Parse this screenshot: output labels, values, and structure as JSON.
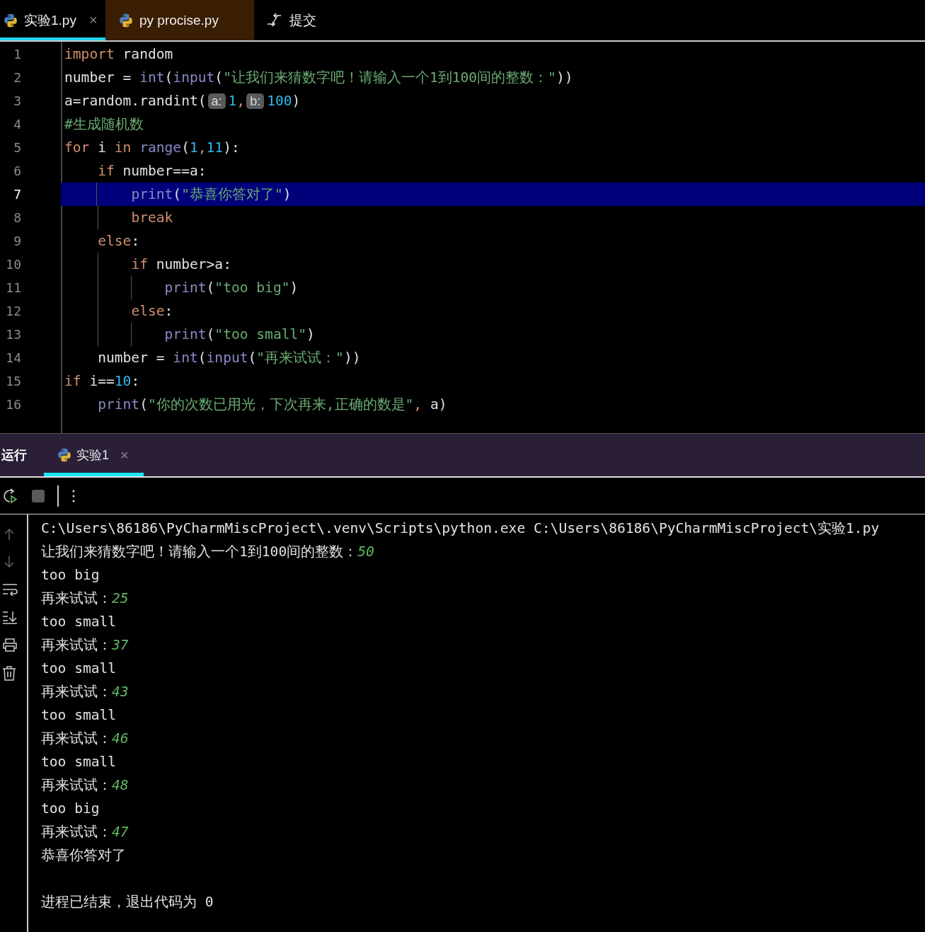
{
  "editor_tabs": [
    {
      "kind": "file",
      "label": "实验1.py",
      "selected": true,
      "close": "×"
    },
    {
      "kind": "file",
      "label": "py procise.py",
      "selected": false,
      "color": "#3a1e03"
    },
    {
      "kind": "action",
      "label": "提交",
      "selected": false
    }
  ],
  "code_lines": [
    {
      "number": "1",
      "selected": false,
      "tokens": [
        {
          "kind": "keyword",
          "text": "import"
        },
        {
          "kind": "plain",
          "text": " random"
        }
      ]
    },
    {
      "number": "2",
      "selected": false,
      "tokens": [
        {
          "kind": "plain",
          "text": "number = "
        },
        {
          "kind": "builtin",
          "text": "int"
        },
        {
          "kind": "plain",
          "text": "("
        },
        {
          "kind": "builtin",
          "text": "input"
        },
        {
          "kind": "plain",
          "text": "("
        },
        {
          "kind": "string",
          "text": "\"让我们来猜数字吧！请输入一个1到100间的整数：\""
        },
        {
          "kind": "plain",
          "text": "))"
        }
      ]
    },
    {
      "number": "3",
      "selected": false,
      "tokens": [
        {
          "kind": "plain",
          "text": "a=random.randint("
        },
        {
          "kind": "hint",
          "text": "a:"
        },
        {
          "kind": "number",
          "text": "1"
        },
        {
          "kind": "keyword",
          "text": ","
        },
        {
          "kind": "hint",
          "text": "b:"
        },
        {
          "kind": "number",
          "text": "100"
        },
        {
          "kind": "plain",
          "text": ")"
        }
      ]
    },
    {
      "number": "4",
      "selected": false,
      "tokens": [
        {
          "kind": "comment",
          "text": "#生成随机数"
        }
      ]
    },
    {
      "number": "5",
      "selected": false,
      "tokens": [
        {
          "kind": "keyword",
          "text": "for"
        },
        {
          "kind": "plain",
          "text": " i "
        },
        {
          "kind": "keyword",
          "text": "in"
        },
        {
          "kind": "builtin",
          "text": " range"
        },
        {
          "kind": "plain",
          "text": "("
        },
        {
          "kind": "number",
          "text": "1"
        },
        {
          "kind": "keyword",
          "text": ","
        },
        {
          "kind": "number",
          "text": "11"
        },
        {
          "kind": "plain",
          "text": "):"
        }
      ]
    },
    {
      "number": "6",
      "selected": false,
      "tokens": [
        {
          "kind": "keyword",
          "text": "    if"
        },
        {
          "kind": "plain",
          "text": " number==a:"
        }
      ]
    },
    {
      "number": "7",
      "selected": true,
      "tokens": [
        {
          "kind": "builtin",
          "text": "        print"
        },
        {
          "kind": "plain",
          "text": "("
        },
        {
          "kind": "string",
          "text": "\"恭喜你答对了\""
        },
        {
          "kind": "plain",
          "text": ")"
        }
      ]
    },
    {
      "number": "8",
      "selected": false,
      "tokens": [
        {
          "kind": "keyword",
          "text": "        break"
        }
      ]
    },
    {
      "number": "9",
      "selected": false,
      "tokens": [
        {
          "kind": "keyword",
          "text": "    else"
        },
        {
          "kind": "plain",
          "text": ":"
        }
      ]
    },
    {
      "number": "10",
      "selected": false,
      "tokens": [
        {
          "kind": "keyword",
          "text": "        if"
        },
        {
          "kind": "plain",
          "text": " number>a:"
        }
      ]
    },
    {
      "number": "11",
      "selected": false,
      "tokens": [
        {
          "kind": "builtin",
          "text": "            print"
        },
        {
          "kind": "plain",
          "text": "("
        },
        {
          "kind": "string",
          "text": "\"too big\""
        },
        {
          "kind": "plain",
          "text": ")"
        }
      ]
    },
    {
      "number": "12",
      "selected": false,
      "tokens": [
        {
          "kind": "keyword",
          "text": "        else"
        },
        {
          "kind": "plain",
          "text": ":"
        }
      ]
    },
    {
      "number": "13",
      "selected": false,
      "tokens": [
        {
          "kind": "builtin",
          "text": "            print"
        },
        {
          "kind": "plain",
          "text": "("
        },
        {
          "kind": "string",
          "text": "\"too small\""
        },
        {
          "kind": "plain",
          "text": ")"
        }
      ]
    },
    {
      "number": "14",
      "selected": false,
      "tokens": [
        {
          "kind": "plain",
          "text": "    number = "
        },
        {
          "kind": "builtin",
          "text": "int"
        },
        {
          "kind": "plain",
          "text": "("
        },
        {
          "kind": "builtin",
          "text": "input"
        },
        {
          "kind": "plain",
          "text": "("
        },
        {
          "kind": "string",
          "text": "\"再来试试：\""
        },
        {
          "kind": "plain",
          "text": "))"
        }
      ]
    },
    {
      "number": "15",
      "selected": false,
      "tokens": [
        {
          "kind": "keyword",
          "text": "if"
        },
        {
          "kind": "plain",
          "text": " i=="
        },
        {
          "kind": "number",
          "text": "10"
        },
        {
          "kind": "plain",
          "text": ":"
        }
      ]
    },
    {
      "number": "16",
      "selected": false,
      "tokens": [
        {
          "kind": "builtin",
          "text": "    print"
        },
        {
          "kind": "plain",
          "text": "("
        },
        {
          "kind": "string",
          "text": "\"你的次数已用光，下次再来,正确的数是\""
        },
        {
          "kind": "keyword",
          "text": ","
        },
        {
          "kind": "plain",
          "text": " a)"
        }
      ]
    }
  ],
  "run_panel": {
    "title": "运行",
    "tabs": [
      {
        "label": "实验1",
        "selected": true,
        "close": "×"
      }
    ]
  },
  "console_lines": [
    {
      "kind": "text",
      "text": "C:\\Users\\86186\\PyCharmMiscProject\\.venv\\Scripts\\python.exe C:\\Users\\86186\\PyCharmMiscProject\\实验1.py"
    },
    {
      "kind": "text",
      "text": "让我们来猜数字吧！请输入一个1到100间的整数：",
      "input": "50"
    },
    {
      "kind": "text",
      "text": "too big"
    },
    {
      "kind": "text",
      "text": "再来试试：",
      "input": "25"
    },
    {
      "kind": "text",
      "text": "too small"
    },
    {
      "kind": "text",
      "text": "再来试试：",
      "input": "37"
    },
    {
      "kind": "text",
      "text": "too small"
    },
    {
      "kind": "text",
      "text": "再来试试：",
      "input": "43"
    },
    {
      "kind": "text",
      "text": "too small"
    },
    {
      "kind": "text",
      "text": "再来试试：",
      "input": "46"
    },
    {
      "kind": "text",
      "text": "too small"
    },
    {
      "kind": "text",
      "text": "再来试试：",
      "input": "48"
    },
    {
      "kind": "text",
      "text": "too big"
    },
    {
      "kind": "text",
      "text": "再来试试：",
      "input": "47"
    },
    {
      "kind": "text",
      "text": "恭喜你答对了"
    },
    {
      "kind": "blank"
    },
    {
      "kind": "text",
      "text": "进程已结束，退出代码为 0"
    }
  ]
}
